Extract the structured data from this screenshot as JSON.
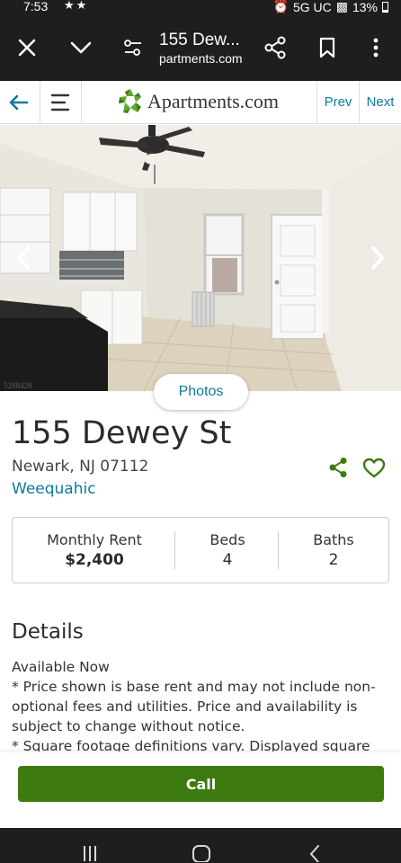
{
  "status_bar": {
    "time": "7:53",
    "network": "5G UC",
    "battery": "13%"
  },
  "browser": {
    "page_title": "155 Dew...",
    "url": "partments.com"
  },
  "site_header": {
    "brand": "Apartments.com",
    "prev_label": "Prev",
    "next_label": "Next",
    "brand_color": "#3d7a0f",
    "link_color": "#0f7a9d"
  },
  "photo": {
    "photo_id": "5288428",
    "photos_button_label": "Photos"
  },
  "listing": {
    "address": "155 Dewey St",
    "city_state_zip": "Newark, NJ 07112",
    "neighborhood": "Weequahic"
  },
  "stats": {
    "rent_label": "Monthly Rent",
    "rent_value": "$2,400",
    "beds_label": "Beds",
    "beds_value": "4",
    "baths_label": "Baths",
    "baths_value": "2"
  },
  "details": {
    "heading": "Details",
    "line1": "Available Now",
    "line2": "* Price shown is base rent and may not include non-optional fees and utilities. Price and availability is subject to change without notice.",
    "line3": "* Square footage definitions vary. Displayed square"
  },
  "actions": {
    "call_label": "Call"
  }
}
